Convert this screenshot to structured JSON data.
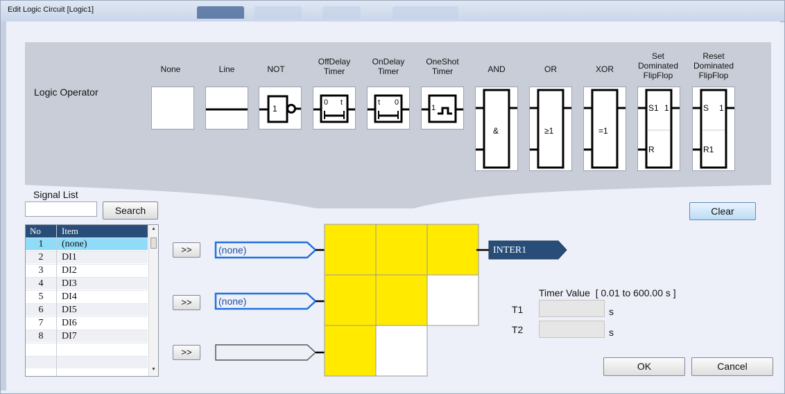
{
  "window": {
    "title": "Edit Logic Circuit [Logic1]"
  },
  "logic_operator": {
    "label": "Logic Operator",
    "operators": [
      {
        "id": "none",
        "label_lines": [
          "None"
        ]
      },
      {
        "id": "line",
        "label_lines": [
          "Line"
        ]
      },
      {
        "id": "not",
        "label_lines": [
          "NOT"
        ],
        "symbol": "1"
      },
      {
        "id": "offdelay",
        "label_lines": [
          "OffDelay",
          "Timer"
        ],
        "symbol_left": "0",
        "symbol_right": "t"
      },
      {
        "id": "ondelay",
        "label_lines": [
          "OnDelay",
          "Timer"
        ],
        "symbol_left": "t",
        "symbol_right": "0"
      },
      {
        "id": "oneshot",
        "label_lines": [
          "OneShot",
          "Timer"
        ],
        "symbol": "1"
      },
      {
        "id": "and",
        "label_lines": [
          "AND"
        ],
        "symbol": "&"
      },
      {
        "id": "or",
        "label_lines": [
          "OR"
        ],
        "symbol": "≥1"
      },
      {
        "id": "xor",
        "label_lines": [
          "XOR"
        ],
        "symbol": "=1"
      },
      {
        "id": "set-ff",
        "label_lines": [
          "Set",
          "Dominated",
          "FlipFlop"
        ],
        "symbol_s": "S1",
        "symbol_q": "1",
        "symbol_r": "R"
      },
      {
        "id": "reset-ff",
        "label_lines": [
          "Reset",
          "Dominated",
          "FlipFlop"
        ],
        "symbol_s": "S",
        "symbol_q": "1",
        "symbol_r": "R1"
      }
    ]
  },
  "signal_list": {
    "title": "Signal List",
    "search_value": "",
    "search_button": "Search",
    "columns": [
      "No",
      "Item"
    ],
    "rows": [
      {
        "no": "1",
        "item": "(none)",
        "selected": true
      },
      {
        "no": "2",
        "item": "DI1"
      },
      {
        "no": "3",
        "item": "DI2"
      },
      {
        "no": "4",
        "item": "DI3"
      },
      {
        "no": "5",
        "item": "DI4"
      },
      {
        "no": "6",
        "item": "DI5"
      },
      {
        "no": "7",
        "item": "DI6"
      },
      {
        "no": "8",
        "item": "DI7"
      }
    ]
  },
  "clear_button": "Clear",
  "inputs": [
    {
      "button": ">>",
      "value": "(none)",
      "highlighted": true
    },
    {
      "button": ">>",
      "value": "(none)",
      "highlighted": true
    },
    {
      "button": ">>",
      "value": "",
      "highlighted": false
    }
  ],
  "output": {
    "value": "INTER1"
  },
  "timer": {
    "label": "Timer Value",
    "range": "[ 0.01 to 600.00 s ]",
    "t1_label": "T1",
    "t1_value": "",
    "t1_unit": "s",
    "t2_label": "T2",
    "t2_value": "",
    "t2_unit": "s"
  },
  "ok_button": "OK",
  "cancel_button": "Cancel",
  "colors": {
    "accent": "#284d78",
    "cell_filled": "#ffea00",
    "selected_row": "#8fdcf8",
    "highlight_border": "#1f6fe0"
  },
  "grid": {
    "cells": [
      [
        true,
        true,
        true
      ],
      [
        true,
        true,
        false
      ],
      [
        true,
        false
      ]
    ]
  }
}
